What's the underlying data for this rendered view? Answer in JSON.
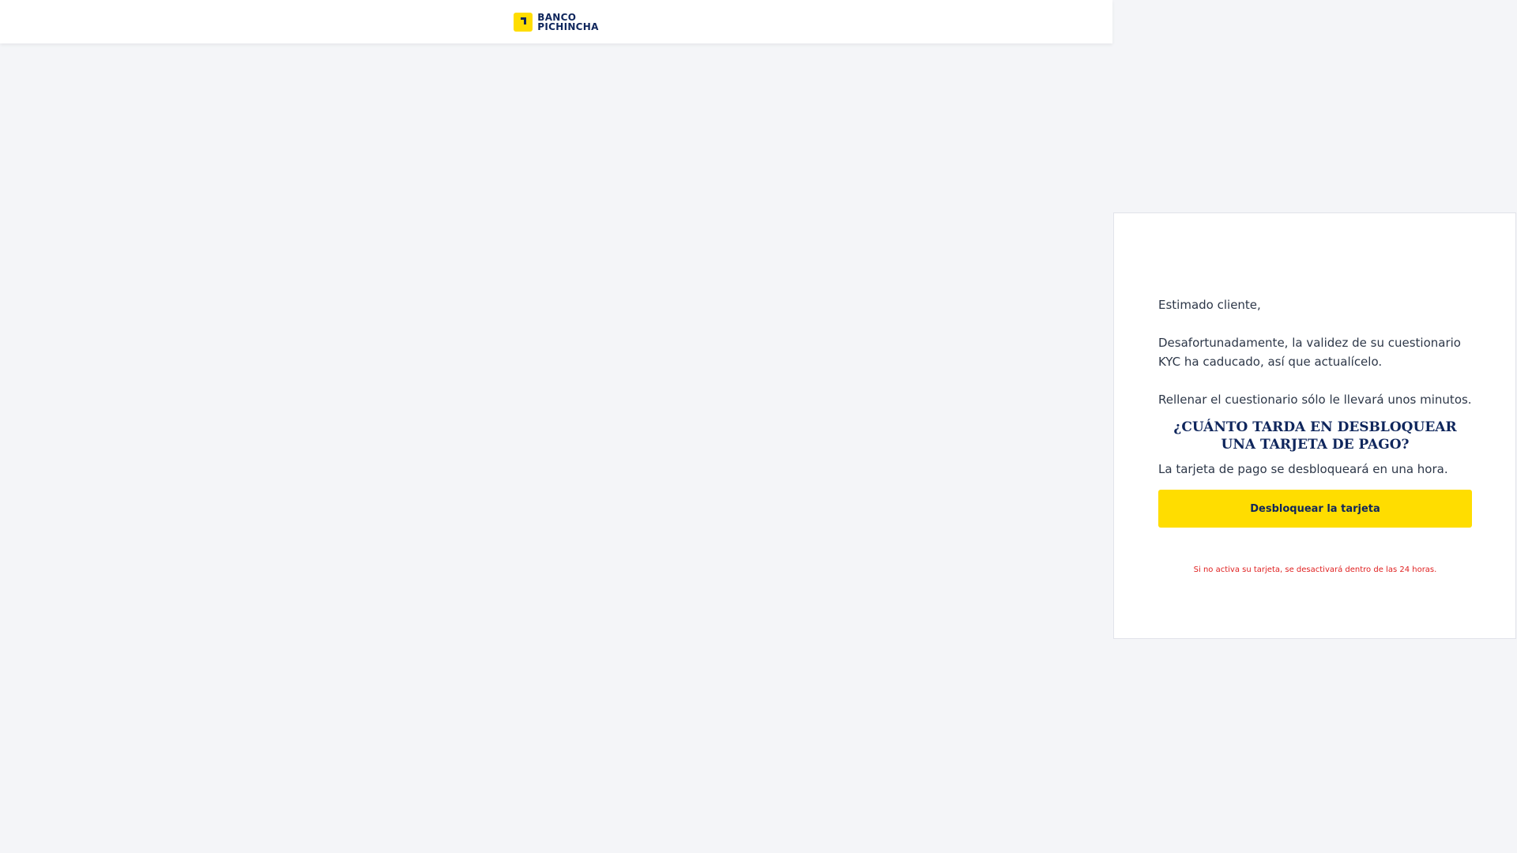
{
  "header": {
    "logo": {
      "line1": "BANCO",
      "line2": "PICHINCHA",
      "mark_icon": "banco-pichincha-logo-mark",
      "brand_color": "#0f265c",
      "accent_color": "#ffdd00"
    }
  },
  "card": {
    "greeting": "Estimado cliente,",
    "message": "Desafortunadamente, la validez de su cuestionario KYC ha caducado, así que actualícelo.",
    "note": "Rellenar el cuestionario sólo le llevará unos minutos.",
    "faq_title": "¿CUÁNTO TARDA EN DESBLOQUEAR UNA TARJETA DE PAGO?",
    "faq_answer": "La tarjeta de pago se desbloqueará en una hora.",
    "button_label": "Desbloquear la tarjeta",
    "warning": "Si no activa su tarjeta, se desactivará dentro de las 24 horas.",
    "warning_color": "#e02020"
  }
}
